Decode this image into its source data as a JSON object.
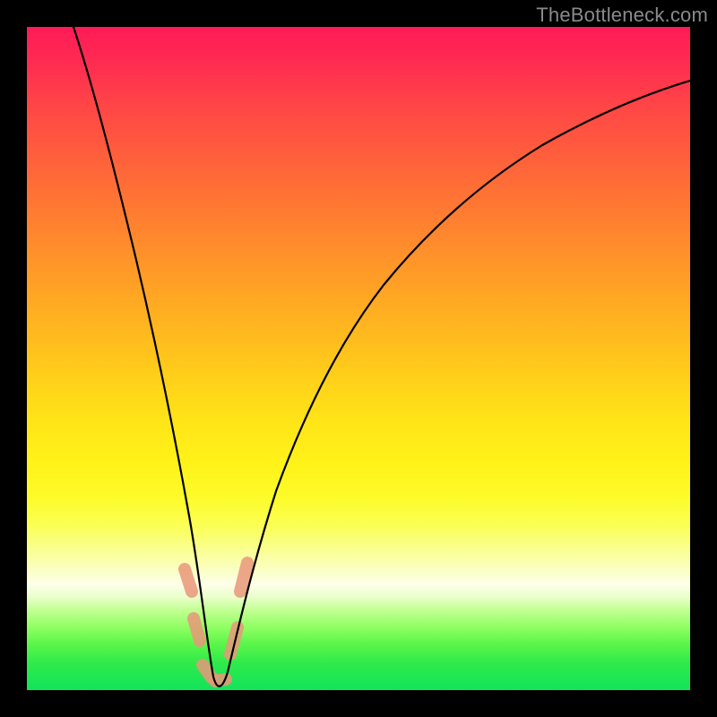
{
  "watermark": "TheBottleneck.com",
  "colors": {
    "frame": "#000000",
    "curve": "#000000",
    "highlight": "#e9967a",
    "watermark": "#8a8a8a"
  },
  "chart_data": {
    "type": "line",
    "title": "",
    "xlabel": "",
    "ylabel": "",
    "xlim": [
      0,
      100
    ],
    "ylim": [
      0,
      100
    ],
    "grid": false,
    "legend": false,
    "notes": "V-shaped bottleneck curve on rainbow gradient. Y decreases downward in screen space; value ~0 at trough (green zone). Left branch is steeper than right branch. Minimum occurs around x≈27.",
    "series": [
      {
        "name": "bottleneck-curve",
        "x": [
          7,
          10,
          13,
          16,
          19,
          22,
          24,
          26,
          27,
          28,
          29,
          30,
          32,
          35,
          40,
          46,
          52,
          58,
          64,
          70,
          76,
          82,
          88,
          94,
          100
        ],
        "values": [
          100,
          88,
          75,
          62,
          49,
          34,
          22,
          10,
          3,
          0,
          2,
          4,
          9,
          17,
          28,
          40,
          50,
          58,
          65,
          71,
          76,
          80,
          83,
          86,
          88
        ]
      }
    ],
    "highlight_points": {
      "description": "Salmon-colored rounded markers near the trough region",
      "x": [
        24.3,
        25.7,
        27.2,
        29.0,
        31.0,
        32.4
      ],
      "y": [
        18,
        8,
        2,
        1,
        6,
        16
      ]
    }
  }
}
